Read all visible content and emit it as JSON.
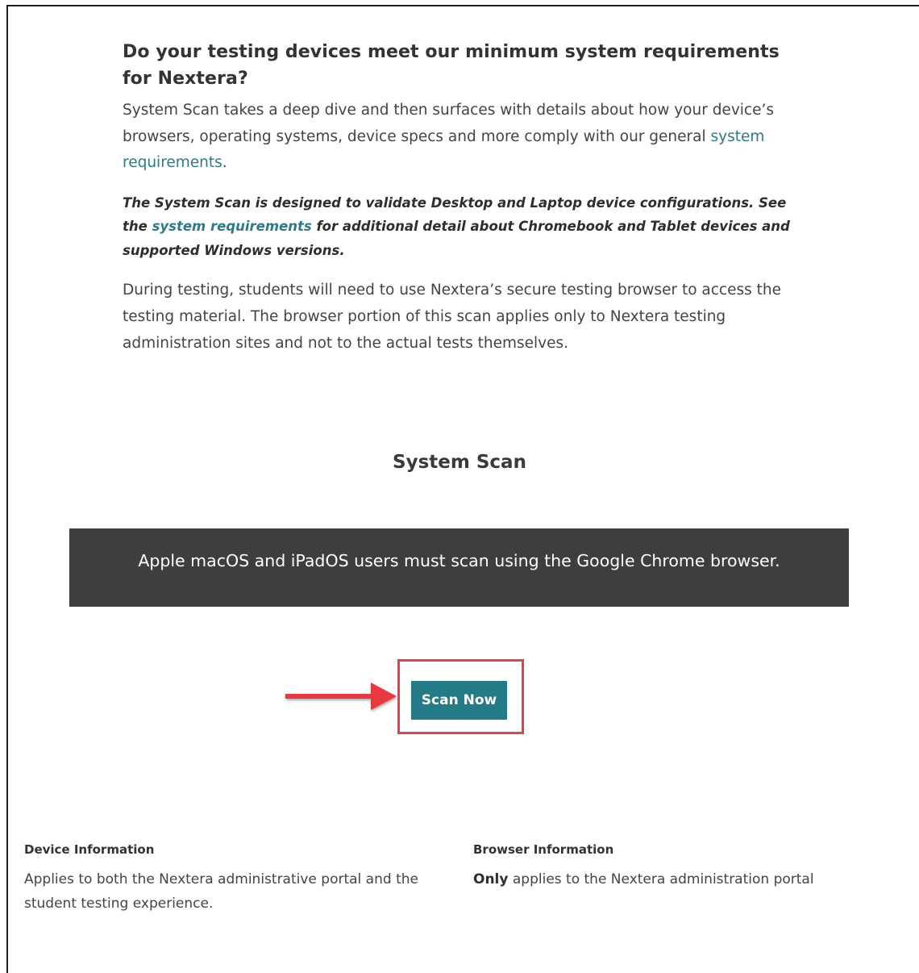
{
  "intro": {
    "heading": "Do your testing devices meet our minimum system requirements for Nextera?",
    "lead_text": "System Scan takes a deep dive and then surfaces with details about how your device’s browsers, operating systems, device specs and more comply with our general ",
    "lead_link": "system requirements",
    "lead_end": ".",
    "note_before": "The System Scan is designed to validate Desktop and Laptop device configurations. See the ",
    "note_link": "system requirements",
    "note_after": " for additional detail about Chromebook and Tablet devices and supported Windows versions.",
    "body": "During testing, students will need to use Nextera’s secure testing browser to access the testing material. The browser portion of this scan applies only to Nextera testing administration sites and not to the actual tests themselves."
  },
  "scan": {
    "heading": "System Scan",
    "banner": "Apple macOS and iPadOS users must scan using the Google Chrome browser.",
    "button_label": "Scan Now"
  },
  "info": {
    "device": {
      "title": "Device Information",
      "text": "Applies to both the Nextera administrative portal and the student testing experience."
    },
    "browser": {
      "title": "Browser Information",
      "text_bold": "Only",
      "text_rest": " applies to the Nextera administration portal"
    }
  },
  "colors": {
    "link": "#2a7b8c",
    "button": "#237b88",
    "banner": "#3e3e3e",
    "highlight": "#e0434a"
  },
  "icons": {
    "callout_arrow": "red-arrow-right-icon"
  }
}
